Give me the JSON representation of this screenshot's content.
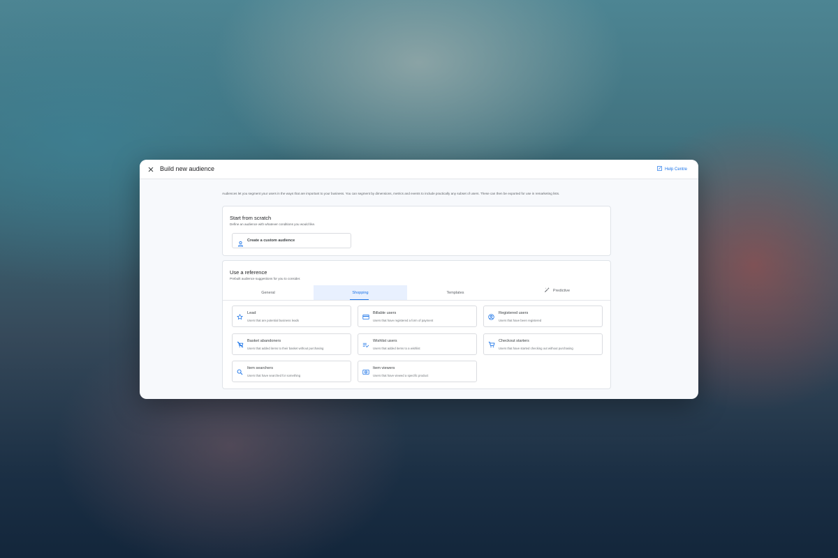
{
  "header": {
    "title": "Build new audience",
    "help_label": "Help Centre"
  },
  "intro_text": "Audiences let you segment your users in the ways that are important to your business. You can segment by dimensions, metrics and events to include practically any subset of users. These can then be exported for use in remarketing lists.",
  "scratch": {
    "title": "Start from scratch",
    "subtitle": "Define an audience with whatever conditions you would like.",
    "button_label": "Create a custom audience"
  },
  "reference": {
    "title": "Use a reference",
    "subtitle": "Prebuilt audience suggestions for you to consider.",
    "tabs": [
      {
        "label": "General"
      },
      {
        "label": "Shopping"
      },
      {
        "label": "Templates"
      },
      {
        "label": "Predictive"
      }
    ],
    "active_tab": "Shopping",
    "items": [
      {
        "title": "Lead",
        "description": "Users that are potential business leads",
        "icon": "star-icon"
      },
      {
        "title": "Billable users",
        "description": "Users that have registered a form of payment",
        "icon": "credit-card-icon"
      },
      {
        "title": "Registered users",
        "description": "Users that have been registered",
        "icon": "account-circle-icon"
      },
      {
        "title": "Basket abandoners",
        "description": "Users that added items to their basket without purchasing",
        "icon": "remove-cart-icon"
      },
      {
        "title": "Wishlist users",
        "description": "Users that added items to a wishlist",
        "icon": "playlist-add-check-icon"
      },
      {
        "title": "Checkout starters",
        "description": "Users that have started checking out without purchasing",
        "icon": "shopping-cart-icon"
      },
      {
        "title": "Item searchers",
        "description": "Users that have searched for something",
        "icon": "search-icon"
      },
      {
        "title": "Item viewers",
        "description": "Users that have viewed a specific product",
        "icon": "product-view-icon"
      }
    ]
  },
  "colors": {
    "accent": "#1a73e8",
    "active_tab_bg": "#e8f0fe",
    "dialog_bg": "#f7f9fc"
  }
}
